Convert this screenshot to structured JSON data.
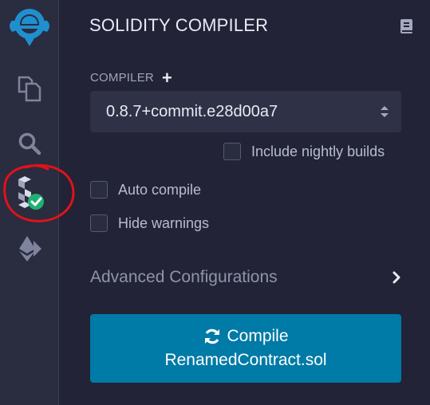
{
  "panel": {
    "title": "SOLIDITY COMPILER"
  },
  "compiler": {
    "label": "COMPILER",
    "add_label": "+",
    "selected_version": "0.8.7+commit.e28d00a7"
  },
  "options": {
    "include_nightly_label": "Include nightly builds",
    "include_nightly_checked": false,
    "auto_compile_label": "Auto compile",
    "auto_compile_checked": false,
    "hide_warnings_label": "Hide warnings",
    "hide_warnings_checked": false
  },
  "advanced": {
    "label": "Advanced Configurations"
  },
  "compile_button": {
    "line1": "Compile",
    "line2": "RenamedContract.sol"
  },
  "sidebar": {
    "icons": [
      "remix-logo-icon",
      "file-explorer-icon",
      "search-icon",
      "solidity-compiler-icon",
      "deploy-run-icon"
    ]
  },
  "colors": {
    "background": "#222336",
    "rail": "#2a2c3f",
    "accent": "#007aa6",
    "success": "#20b073",
    "annotation": "#e0121b"
  }
}
